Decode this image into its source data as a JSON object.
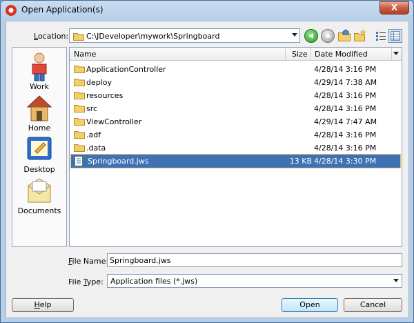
{
  "window": {
    "title": "Open Application(s)",
    "close_label": "X"
  },
  "location": {
    "label_prefix": "L",
    "label_rest": "ocation:",
    "value": "C:\\JDeveloper\\mywork\\Springboard"
  },
  "toolbar": {
    "icons": [
      "back-icon",
      "up-folder-icon",
      "home-folder-icon",
      "new-folder-icon",
      "list-view-icon",
      "details-view-icon"
    ]
  },
  "places": [
    {
      "label": "Work",
      "icon": "work-person-icon"
    },
    {
      "label": "Home",
      "icon": "home-house-icon"
    },
    {
      "label": "Desktop",
      "icon": "desktop-icon"
    },
    {
      "label": "Documents",
      "icon": "documents-icon"
    }
  ],
  "filelist": {
    "columns": {
      "name": "Name",
      "size": "Size",
      "modified": "Date Modified"
    },
    "rows": [
      {
        "name": "ApplicationController",
        "size": "",
        "modified": "4/28/14 3:16 PM",
        "type": "folder"
      },
      {
        "name": "deploy",
        "size": "",
        "modified": "4/29/14 7:38 AM",
        "type": "folder"
      },
      {
        "name": "resources",
        "size": "",
        "modified": "4/28/14 3:16 PM",
        "type": "folder"
      },
      {
        "name": "src",
        "size": "",
        "modified": "4/28/14 3:16 PM",
        "type": "folder"
      },
      {
        "name": "ViewController",
        "size": "",
        "modified": "4/29/14 7:47 AM",
        "type": "folder"
      },
      {
        "name": ".adf",
        "size": "",
        "modified": "4/28/14 3:16 PM",
        "type": "folder"
      },
      {
        "name": ".data",
        "size": "",
        "modified": "4/28/14 3:16 PM",
        "type": "folder"
      },
      {
        "name": "Springboard.jws",
        "size": "13 KB",
        "modified": "4/28/14 3:30 PM",
        "type": "file",
        "selected": true
      }
    ]
  },
  "file_name": {
    "label_prefix": "F",
    "label_rest": "ile Name:",
    "value": "Springboard.jws"
  },
  "file_type": {
    "label_prefix": "File ",
    "label_u": "T",
    "label_rest": "ype:",
    "value": "Application files  (*.jws)"
  },
  "buttons": {
    "help": "Help",
    "help_u": "H",
    "open": "Open",
    "cancel": "Cancel"
  },
  "colors": {
    "selection": "#3d72b4",
    "title_bar": "#b7cfe9",
    "close": "#c75b44"
  }
}
